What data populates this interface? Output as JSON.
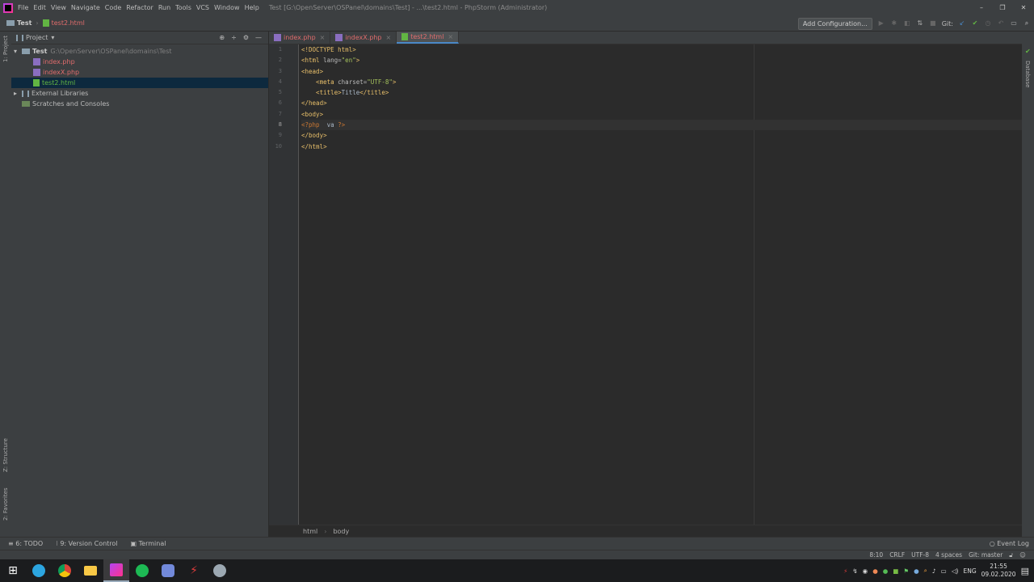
{
  "window": {
    "title": "Test [G:\\OpenServer\\OSPanel\\domains\\Test] - ...\\test2.html - PhpStorm (Administrator)",
    "menu": [
      "File",
      "Edit",
      "View",
      "Navigate",
      "Code",
      "Refactor",
      "Run",
      "Tools",
      "VCS",
      "Window",
      "Help"
    ],
    "controls": [
      "–",
      "❐",
      "✕"
    ]
  },
  "navbar": {
    "project": "Test",
    "file": "test2.html",
    "add_config": "Add Configuration...",
    "git_label": "Git:"
  },
  "leftstrip": {
    "project": "1: Project",
    "structure": "Z: Structure",
    "favorites": "2: Favorites"
  },
  "rightstrip": {
    "database": "Database"
  },
  "project_panel": {
    "title": "Project",
    "root_name": "Test",
    "root_path": "G:\\OpenServer\\OSPanel\\domains\\Test",
    "files": [
      "index.php",
      "indexX.php",
      "test2.html"
    ],
    "external": "External Libraries",
    "scratches": "Scratches and Consoles"
  },
  "tabs": [
    {
      "label": "index.php"
    },
    {
      "label": "indexX.php"
    },
    {
      "label": "test2.html"
    }
  ],
  "code": {
    "line_numbers": [
      "1",
      "2",
      "3",
      "4",
      "5",
      "6",
      "7",
      "8",
      "9",
      "10"
    ],
    "l1": "<!DOCTYPE html>",
    "l2a": "<html ",
    "l2b": "lang=",
    "l2c": "\"en\"",
    "l2d": ">",
    "l3": "<head>",
    "l4a": "    <meta ",
    "l4b": "charset=",
    "l4c": "\"UTF-8\"",
    "l4d": ">",
    "l5a": "    <title>",
    "l5b": "Title",
    "l5c": "</title>",
    "l6": "</head>",
    "l7": "<body>",
    "l8a": "<?php",
    "l8b": "  va ",
    "l8c": "?>",
    "l9": "</body>",
    "l10": "</html>"
  },
  "breadcrumbs": [
    "html",
    "body"
  ],
  "bottom_tools": {
    "todo": "6: TODO",
    "vcs": "9: Version Control",
    "terminal": "Terminal",
    "event_log": "Event Log"
  },
  "status": {
    "pos": "8:10",
    "eol": "CRLF",
    "enc": "UTF-8",
    "indent": "4 spaces",
    "git": "Git: master"
  },
  "taskbar": {
    "lang": "ENG",
    "time": "21:55",
    "date": "09.02.2020"
  },
  "colors": {
    "tag": "#e8bf6a",
    "string": "#a5c25c",
    "keyword": "#cc7832",
    "selection": "#0d293e",
    "tab_underline": "#4a88c7"
  }
}
